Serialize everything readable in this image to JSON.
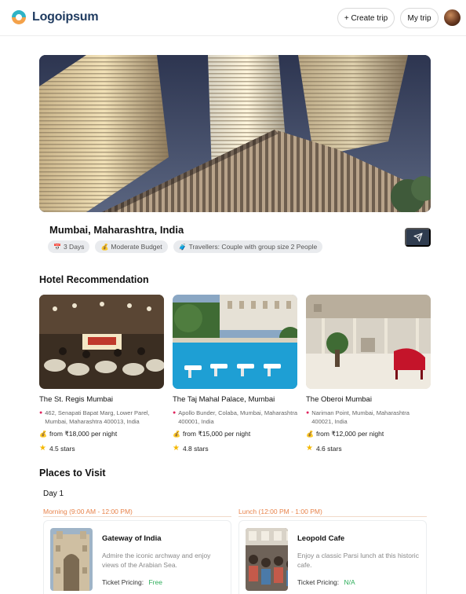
{
  "header": {
    "logo_text": "Logoipsum",
    "create_trip_label": "+ Create trip",
    "my_trip_label": "My trip"
  },
  "destination": {
    "title": "Mumbai, Maharashtra, India",
    "chips": [
      {
        "icon": "calendar-icon",
        "label": "3 Days"
      },
      {
        "icon": "money-bag-icon",
        "label": "Moderate Budget"
      },
      {
        "icon": "travellers-icon",
        "label": "Travellers: Couple with group size 2 People"
      }
    ]
  },
  "hotels": {
    "section_title": "Hotel Recommendation",
    "items": [
      {
        "name": "The St. Regis Mumbai",
        "address": "462, Senapati Bapat Marg, Lower Parel, Mumbai, Maharashtra 400013, India",
        "price": "from ₹18,000 per night",
        "rating": "4.5 stars"
      },
      {
        "name": "The Taj Mahal Palace, Mumbai",
        "address": "Apollo Bunder, Colaba, Mumbai, Maharashtra 400001, India",
        "price": "from ₹15,000 per night",
        "rating": "4.8 stars"
      },
      {
        "name": "The Oberoi Mumbai",
        "address": "Nariman Point, Mumbai, Maharashtra 400021, India",
        "price": "from ₹12,000 per night",
        "rating": "4.6 stars"
      }
    ]
  },
  "places": {
    "section_title": "Places to Visit",
    "day_label": "Day 1",
    "slots": [
      {
        "time": "Morning (9:00 AM - 12:00 PM)",
        "name": "Gateway of India",
        "description": "Admire the iconic archway and enjoy views of the Arabian Sea.",
        "ticket_label": "Ticket Pricing:",
        "ticket_value": "Free"
      },
      {
        "time": "Lunch (12:00 PM - 1:00 PM)",
        "name": "Leopold Cafe",
        "description": "Enjoy a classic Parsi lunch at this historic cafe.",
        "ticket_label": "Ticket Pricing:",
        "ticket_value": "N/A"
      }
    ]
  },
  "colors": {
    "accent": "#2f3c4f",
    "slot_orange": "#e8834a",
    "ticket_green": "#2eae5b",
    "star": "#f5b800"
  }
}
